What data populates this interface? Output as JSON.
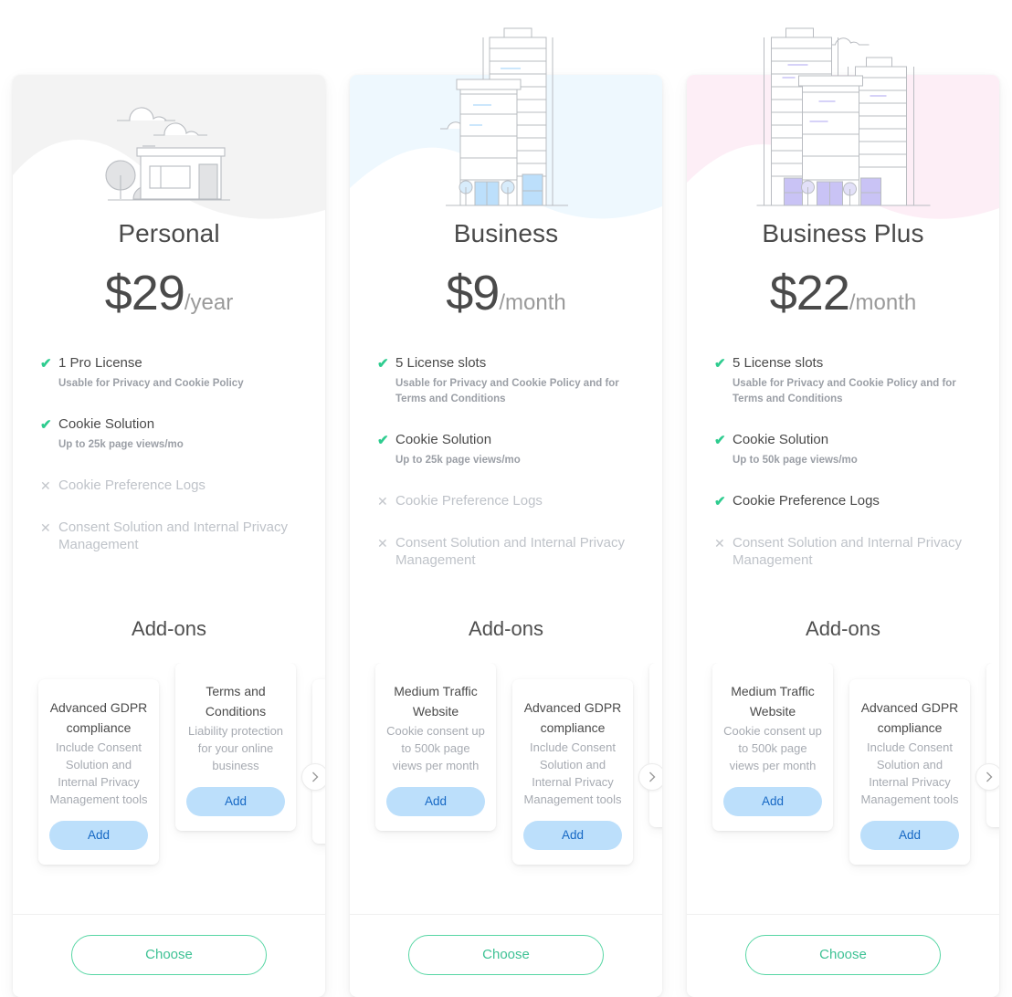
{
  "colors": {
    "check_green": "#2ecc8f",
    "cross_grey": "#c3c6cb",
    "add_btn_bg": "#bcdffb",
    "add_btn_text": "#1668c4",
    "choose_border": "#57d6a4",
    "choose_text": "#3fc295",
    "tint_personal": "#f3f3f3",
    "tint_business": "#eef8fe",
    "tint_plus": "#fdeef6"
  },
  "plans": [
    {
      "id": "personal",
      "name": "Personal",
      "price": "$29",
      "unit": "/year",
      "illustration": "single-story-shop-illustration",
      "features": [
        {
          "included": true,
          "title": "1 Pro License",
          "sub": "Usable for Privacy and Cookie Policy"
        },
        {
          "included": true,
          "title": "Cookie Solution",
          "sub": "Up to 25k page views/mo"
        },
        {
          "included": false,
          "title": "Cookie Preference Logs",
          "sub": ""
        },
        {
          "included": false,
          "title": "Consent Solution and Internal Privacy Management",
          "sub": ""
        }
      ],
      "addons_title": "Add-ons",
      "addons": [
        {
          "title": "Advanced GDPR compliance",
          "desc": "Include Consent Solution and Internal Privacy Management tools",
          "add_label": "Add"
        },
        {
          "title": "Terms and Conditions",
          "desc": "Liability protection for your online business",
          "add_label": "Add"
        },
        {
          "title": "",
          "desc": "",
          "add_label": ""
        }
      ],
      "choose_label": "Choose"
    },
    {
      "id": "business",
      "name": "Business",
      "price": "$9",
      "unit": "/month",
      "illustration": "mid-rise-buildings-illustration",
      "features": [
        {
          "included": true,
          "title": "5 License slots",
          "sub": "Usable for Privacy and Cookie Policy and for Terms and Conditions"
        },
        {
          "included": true,
          "title": "Cookie Solution",
          "sub": "Up to 25k page views/mo"
        },
        {
          "included": false,
          "title": "Cookie Preference Logs",
          "sub": ""
        },
        {
          "included": false,
          "title": "Consent Solution and Internal Privacy Management",
          "sub": ""
        }
      ],
      "addons_title": "Add-ons",
      "addons": [
        {
          "title": "Medium Traffic Website",
          "desc": "Cookie consent up to 500k page views per month",
          "add_label": "Add"
        },
        {
          "title": "Advanced GDPR compliance",
          "desc": "Include Consent Solution and Internal Privacy Management tools",
          "add_label": "Add"
        },
        {
          "title": "",
          "desc": "",
          "add_label": ""
        }
      ],
      "choose_label": "Choose"
    },
    {
      "id": "business-plus",
      "name": "Business Plus",
      "price": "$22",
      "unit": "/month",
      "illustration": "high-rise-buildings-illustration",
      "features": [
        {
          "included": true,
          "title": "5 License slots",
          "sub": "Usable for Privacy and Cookie Policy and for Terms and Conditions"
        },
        {
          "included": true,
          "title": "Cookie Solution",
          "sub": "Up to 50k page views/mo"
        },
        {
          "included": true,
          "title": "Cookie Preference Logs",
          "sub": ""
        },
        {
          "included": false,
          "title": "Consent Solution and Internal Privacy Management",
          "sub": ""
        }
      ],
      "addons_title": "Add-ons",
      "addons": [
        {
          "title": "Medium Traffic Website",
          "desc": "Cookie consent up to 500k page views per month",
          "add_label": "Add"
        },
        {
          "title": "Advanced GDPR compliance",
          "desc": "Include Consent Solution and Internal Privacy Management tools",
          "add_label": "Add"
        },
        {
          "title": "",
          "desc": "",
          "add_label": ""
        }
      ],
      "choose_label": "Choose"
    }
  ]
}
